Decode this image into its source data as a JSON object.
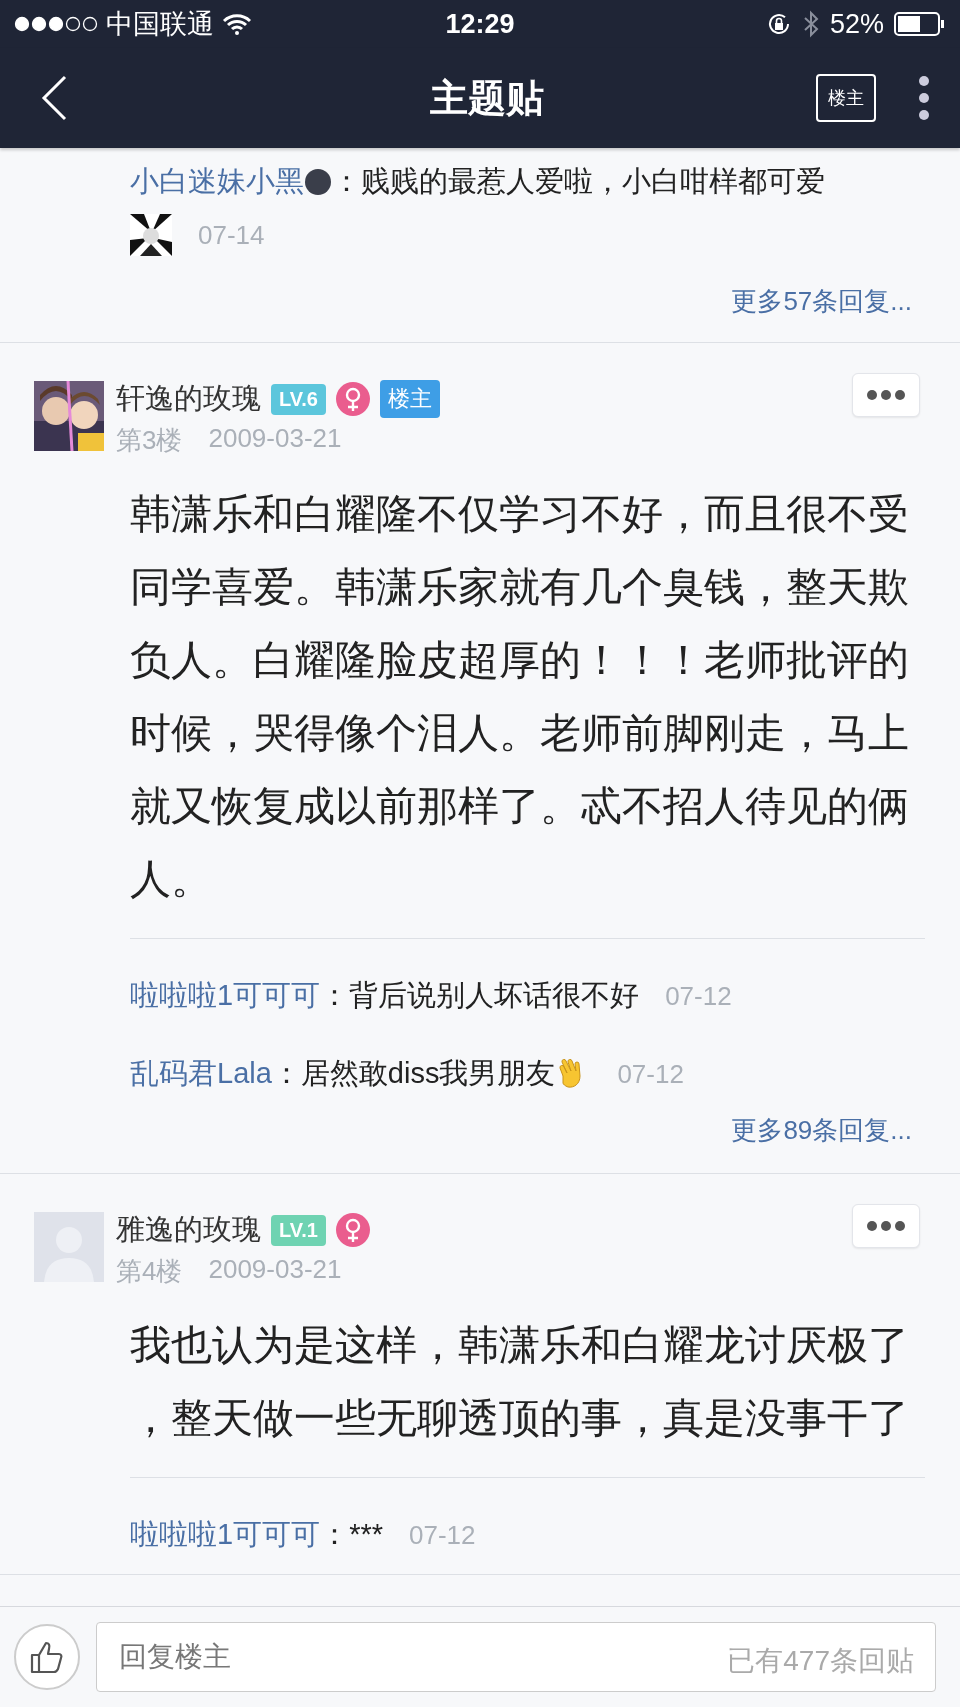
{
  "status_bar": {
    "carrier": "中国联通",
    "time": "12:29",
    "battery": "52%"
  },
  "nav": {
    "title": "主题贴",
    "op_button": "楼主"
  },
  "top_thread": {
    "comment": {
      "user": "小白迷妹小黑",
      "text": "：贱贱的最惹人爱啦，小白咁样都可爱",
      "date": "07-14"
    },
    "more": "更多57条回复..."
  },
  "posts": [
    {
      "name": "轩逸的玫瑰",
      "level": "LV.6",
      "color": "#5cc6dc",
      "op_badge": "楼主",
      "floor": "第3楼",
      "date": "2009-03-21",
      "body": "韩潇乐和白耀隆不仅学习不好，而且很不受同学喜爱。韩潇乐家就有几个臭钱，整天欺负人。白耀隆脸皮超厚的！！！老师批评的时候，哭得像个泪人。老师前脚刚走，马上就又恢复成以前那样了。忒不招人待见的俩人。",
      "replies": [
        {
          "user": "啦啦啦1可可可",
          "text": "：背后说别人坏话很不好",
          "has_emoji": false,
          "date": "07-12"
        },
        {
          "user": "乱码君Lala",
          "text": "：居然敢diss我男朋友",
          "has_emoji": true,
          "date": "07-12"
        }
      ],
      "more": "更多89条回复..."
    },
    {
      "name": "雅逸的玫瑰",
      "level": "LV.1",
      "color": "#6fd3b2",
      "avatar": {
        "kind": "silhouette"
      },
      "floor": "第4楼",
      "date": "2009-03-21",
      "body": "我也认为是这样，韩潇乐和白耀龙讨厌极了，整天做一些无聊透顶的事，真是没事干了",
      "replies": [
        {
          "user": "啦啦啦1可可可",
          "text": "：***",
          "has_emoji": false,
          "date": "07-12"
        }
      ]
    }
  ],
  "bottom_bar": {
    "placeholder": "回复楼主",
    "reply_count": "已有477条回贴"
  }
}
